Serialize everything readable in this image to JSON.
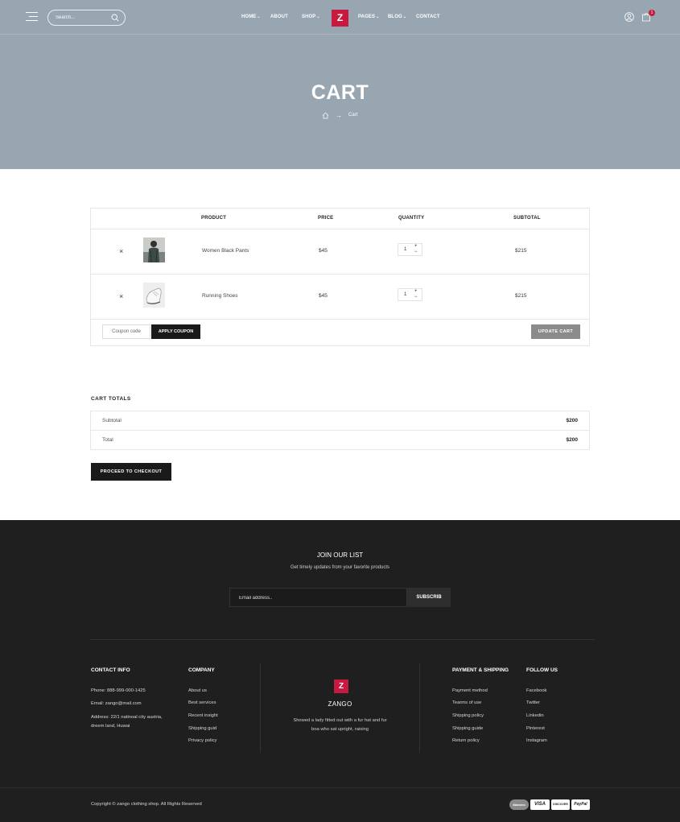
{
  "header": {
    "search_placeholder": "Search...",
    "nav": [
      {
        "label": "HOME",
        "dropdown": true
      },
      {
        "label": "ABOUT",
        "dropdown": false
      },
      {
        "label": "SHOP",
        "dropdown": true
      },
      {
        "label": "PAGES",
        "dropdown": true
      },
      {
        "label": "BLOG",
        "dropdown": true
      },
      {
        "label": "CONTACT",
        "dropdown": false
      }
    ],
    "logo_letter": "Z",
    "cart_count": "1",
    "icons": [
      "menu-icon",
      "search-icon",
      "user-icon",
      "cart-icon"
    ]
  },
  "hero": {
    "title": "CART",
    "breadcrumb_current": "Cart"
  },
  "cart": {
    "headers": {
      "product": "PRODUCT",
      "price": "PRICE",
      "quantity": "QUANTITY",
      "subtotal": "SUBTOTAL"
    },
    "items": [
      {
        "remove": "×",
        "name": "Women Black Pants",
        "price": "$45",
        "qty": "1",
        "subtotal": "$215"
      },
      {
        "remove": "×",
        "name": "Running Shoes",
        "price": "$45",
        "qty": "1",
        "subtotal": "$215"
      }
    ],
    "coupon_placeholder": "Coupon code",
    "apply_label": "APPLY COUPON",
    "update_label": "UPDATE CART"
  },
  "totals": {
    "title": "CART TOTALS",
    "subtotal_label": "Subtotal",
    "subtotal_value": "$200",
    "total_label": "Total",
    "total_value": "$200",
    "checkout_label": "PROCEED TO CHECKOUT"
  },
  "footer": {
    "join_title": "JOIN OUR LIST",
    "join_sub": "Get timely updates from your favorite products",
    "email_placeholder": "Email address..",
    "subscribe_label": "SUBSCRIB",
    "contact": {
      "title": "CONTACT INFO",
      "phone": "Phone: 888-999-000-1425",
      "email": "Email: zango@mail.com",
      "address": "Address: 22/1 natinoal city austria, dreem land, Huwai"
    },
    "company": {
      "title": "COMPANY",
      "links": [
        "About us",
        "Best services",
        "Recent insight",
        "Shipping guid",
        "Privacy policy"
      ]
    },
    "brand": {
      "logo_letter": "Z",
      "name": "ZANGO",
      "desc": "Showed a lady fitted out with a fur hat and fur boa who sat upright, raising"
    },
    "payment": {
      "title": "PAYMENT & SHIPPING",
      "links": [
        "Payment method",
        "Tearms of use",
        "Shipping policy",
        "Shipping guide",
        "Return policy"
      ]
    },
    "follow": {
      "title": "FOLLOW US",
      "links": [
        "Facebook",
        "Twitter",
        "Linkedin",
        "Pinterest",
        "Instagram"
      ]
    },
    "copyright": "Copyright © zango clothing shop. All Rights Reserved",
    "payment_cards": [
      "Maestro",
      "VISA",
      "DISCOVER",
      "PayPal"
    ]
  },
  "colors": {
    "hero_bg": "#98a6b1",
    "brand_red": "#c8193e",
    "footer_bg": "#1f1f1f",
    "dark_button": "#1a1a1a",
    "update_button": "#8b8b8b"
  }
}
